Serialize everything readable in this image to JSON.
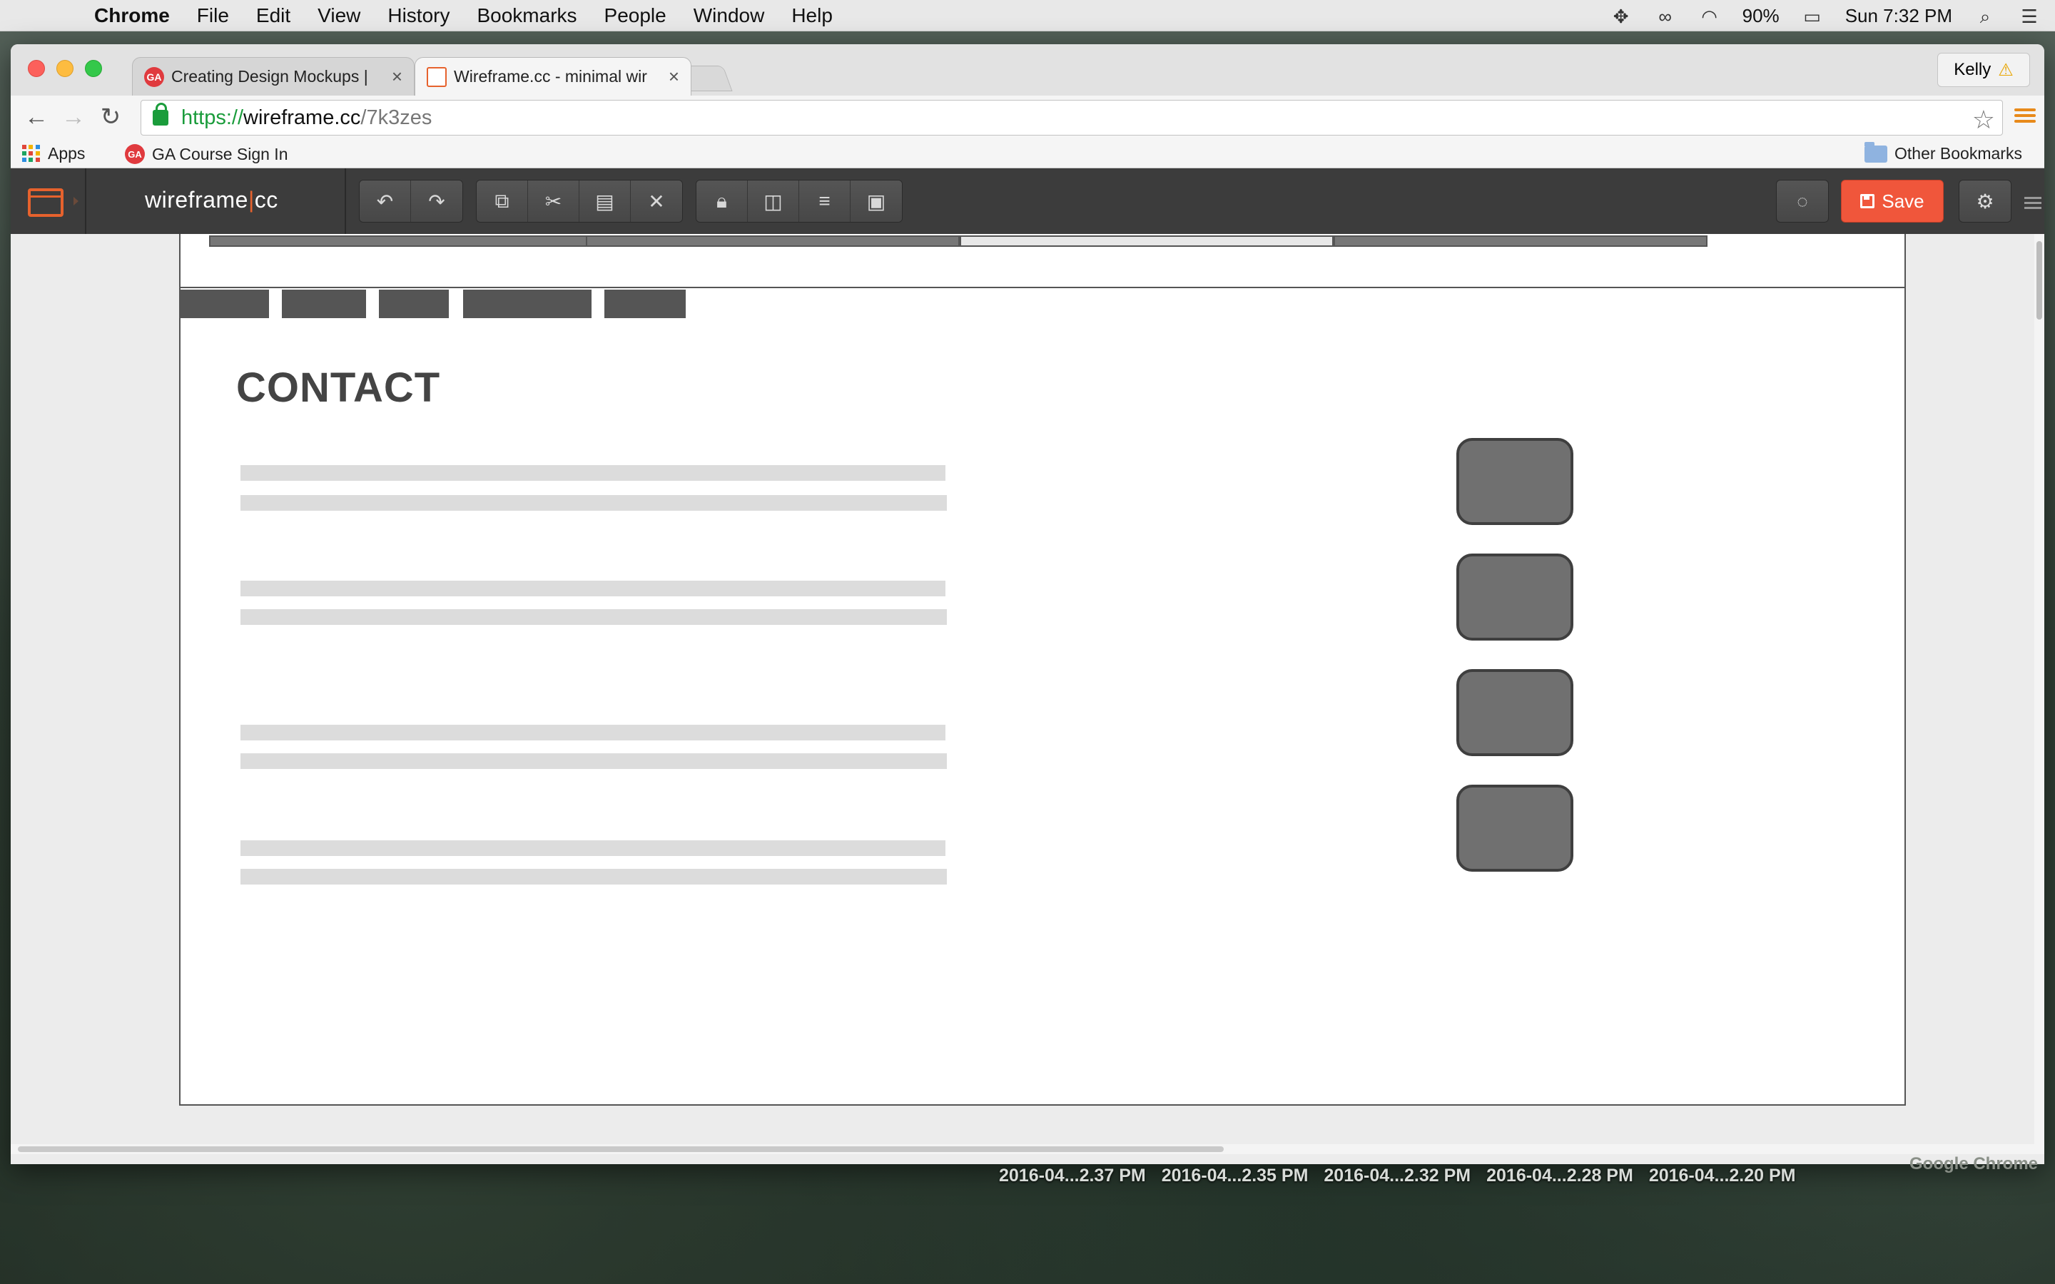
{
  "menubar": {
    "app_name": "Chrome",
    "items": [
      "File",
      "Edit",
      "View",
      "History",
      "Bookmarks",
      "People",
      "Window",
      "Help"
    ],
    "battery": "90%",
    "clock": "Sun 7:32 PM"
  },
  "browser": {
    "tabs": [
      {
        "title": "Creating Design Mockups |",
        "favicon": "GA",
        "active": false
      },
      {
        "title": "Wireframe.cc - minimal wir",
        "favicon": "wireframe-icon",
        "active": true
      }
    ],
    "profile_name": "Kelly",
    "url": {
      "scheme": "https://",
      "host": "wireframe.cc",
      "path": "/7k3zes"
    },
    "bookmarks": {
      "apps_label": "Apps",
      "ga_label": "GA Course Sign In",
      "other_label": "Other Bookmarks"
    }
  },
  "app": {
    "logo_text_a": "wireframe",
    "logo_text_sep": "|",
    "logo_text_b": "cc",
    "save_label": "Save"
  },
  "wireframe": {
    "heading": "CONTACT"
  },
  "desktop": {
    "files": [
      "2016-04...2.37 PM",
      "2016-04...2.35 PM",
      "2016-04...2.32 PM",
      "2016-04...2.28 PM",
      "2016-04...2.20 PM"
    ],
    "ghost_label": "Google Chrome"
  },
  "colors": {
    "accent": "#e6622d",
    "save": "#f0563b",
    "secure": "#1a9c3b"
  }
}
